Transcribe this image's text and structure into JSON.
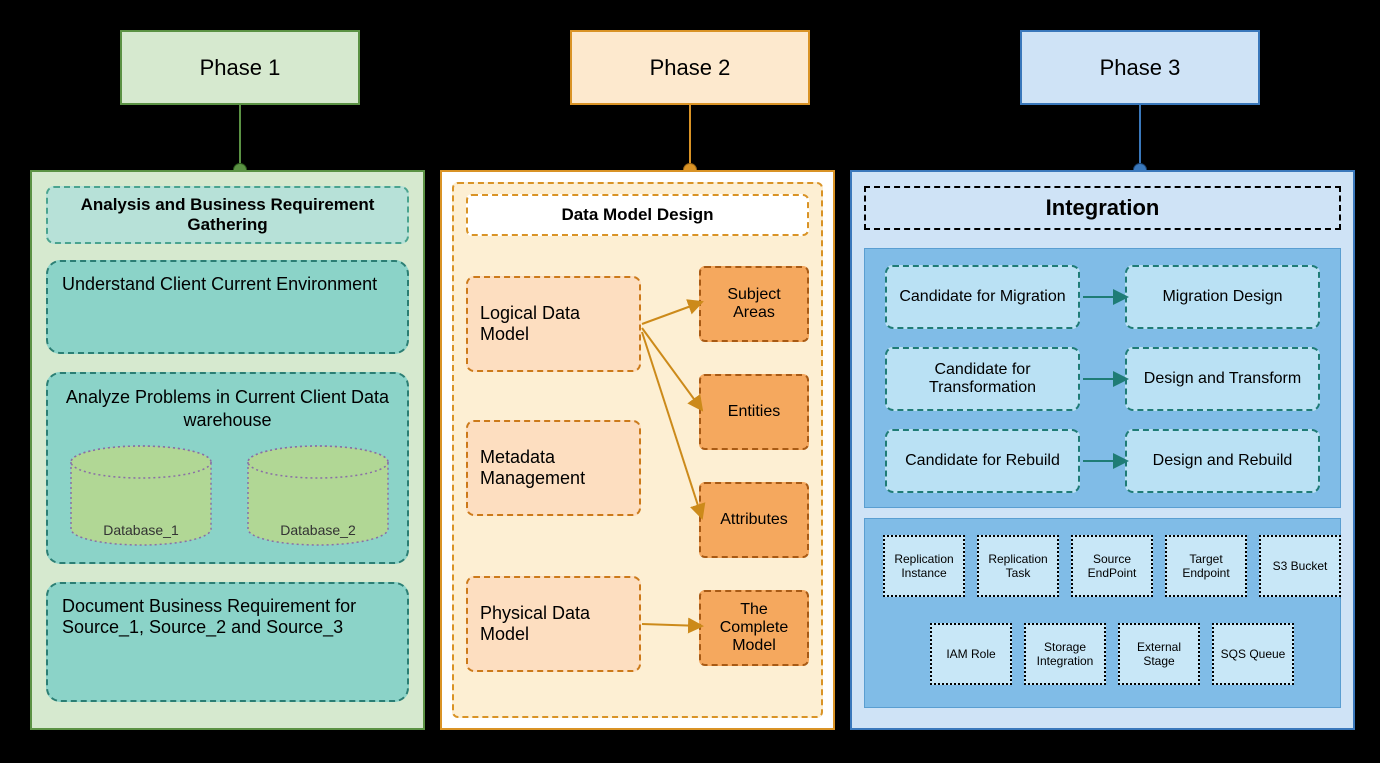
{
  "phase1": {
    "header": "Phase 1",
    "title": "Analysis and Business Requirement Gathering",
    "box1": "Understand Client Current Environment",
    "box2_title": "Analyze Problems in Current Client Data warehouse",
    "db1": "Database_1",
    "db2": "Database_2",
    "box3": "Document Business Requirement for Source_1, Source_2 and Source_3"
  },
  "phase2": {
    "header": "Phase 2",
    "title": "Data Model Design",
    "left1": "Logical Data Model",
    "left2": "Metadata Management",
    "left3": "Physical Data Model",
    "right1": "Subject Areas",
    "right2": "Entities",
    "right3": "Attributes",
    "right4": "The Complete Model"
  },
  "phase3": {
    "header": "Phase 3",
    "title": "Integration",
    "cand1": "Candidate for Migration",
    "cand2": "Candidate for Transformation",
    "cand3": "Candidate for Rebuild",
    "des1": "Migration Design",
    "des2": "Design and Transform",
    "des3": "Design and Rebuild",
    "small": {
      "r1c1": "Replication Instance",
      "r1c2": "Replication Task",
      "r1c3": "Source EndPoint",
      "r1c4": "Target Endpoint",
      "r1c5": "S3 Bucket",
      "r2c1": "IAM Role",
      "r2c2": "Storage Integration",
      "r2c3": "External Stage",
      "r2c4": "SQS Queue"
    }
  }
}
